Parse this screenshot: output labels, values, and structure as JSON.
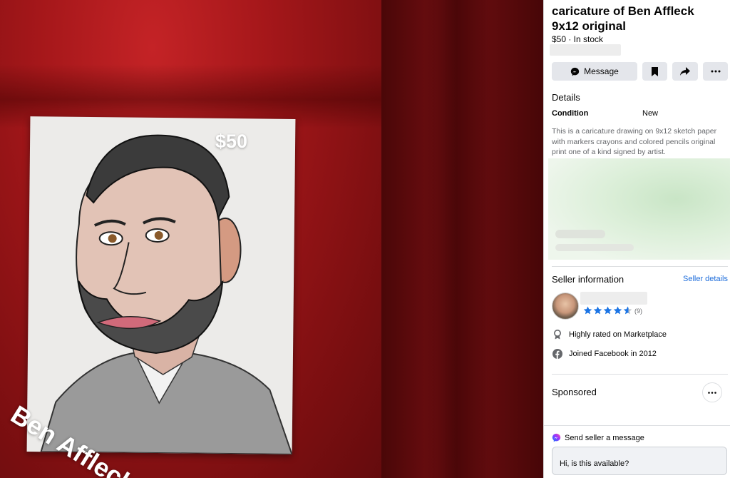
{
  "media": {
    "price_overlay": "$50",
    "name_overlay": "Ben Affleck"
  },
  "listing": {
    "title": "caricature of Ben Affleck 9x12 original",
    "price_status": "$50 · In stock"
  },
  "actions": {
    "message_label": "Message",
    "save_icon": "bookmark-icon",
    "share_icon": "share-icon",
    "more_icon": "more-dots-icon"
  },
  "details": {
    "heading": "Details",
    "condition_label": "Condition",
    "condition_value": "New",
    "description": "This is a caricature drawing on 9x12 sketch paper with markers crayons and colored pencils original print one of a kind signed by artist."
  },
  "seller": {
    "heading": "Seller information",
    "details_link": "Seller details",
    "rating_stars": 4.5,
    "rating_count": "(9)",
    "badge_text": "Highly rated on Marketplace",
    "joined_text": "Joined Facebook in 2012"
  },
  "sponsored": {
    "heading": "Sponsored"
  },
  "footer": {
    "send_label": "Send seller a message",
    "message_value": "Hi, is this available?"
  },
  "colors": {
    "accent_blue": "#216fdb",
    "star_blue": "#1b74e4",
    "button_bg": "#e4e6eb"
  }
}
